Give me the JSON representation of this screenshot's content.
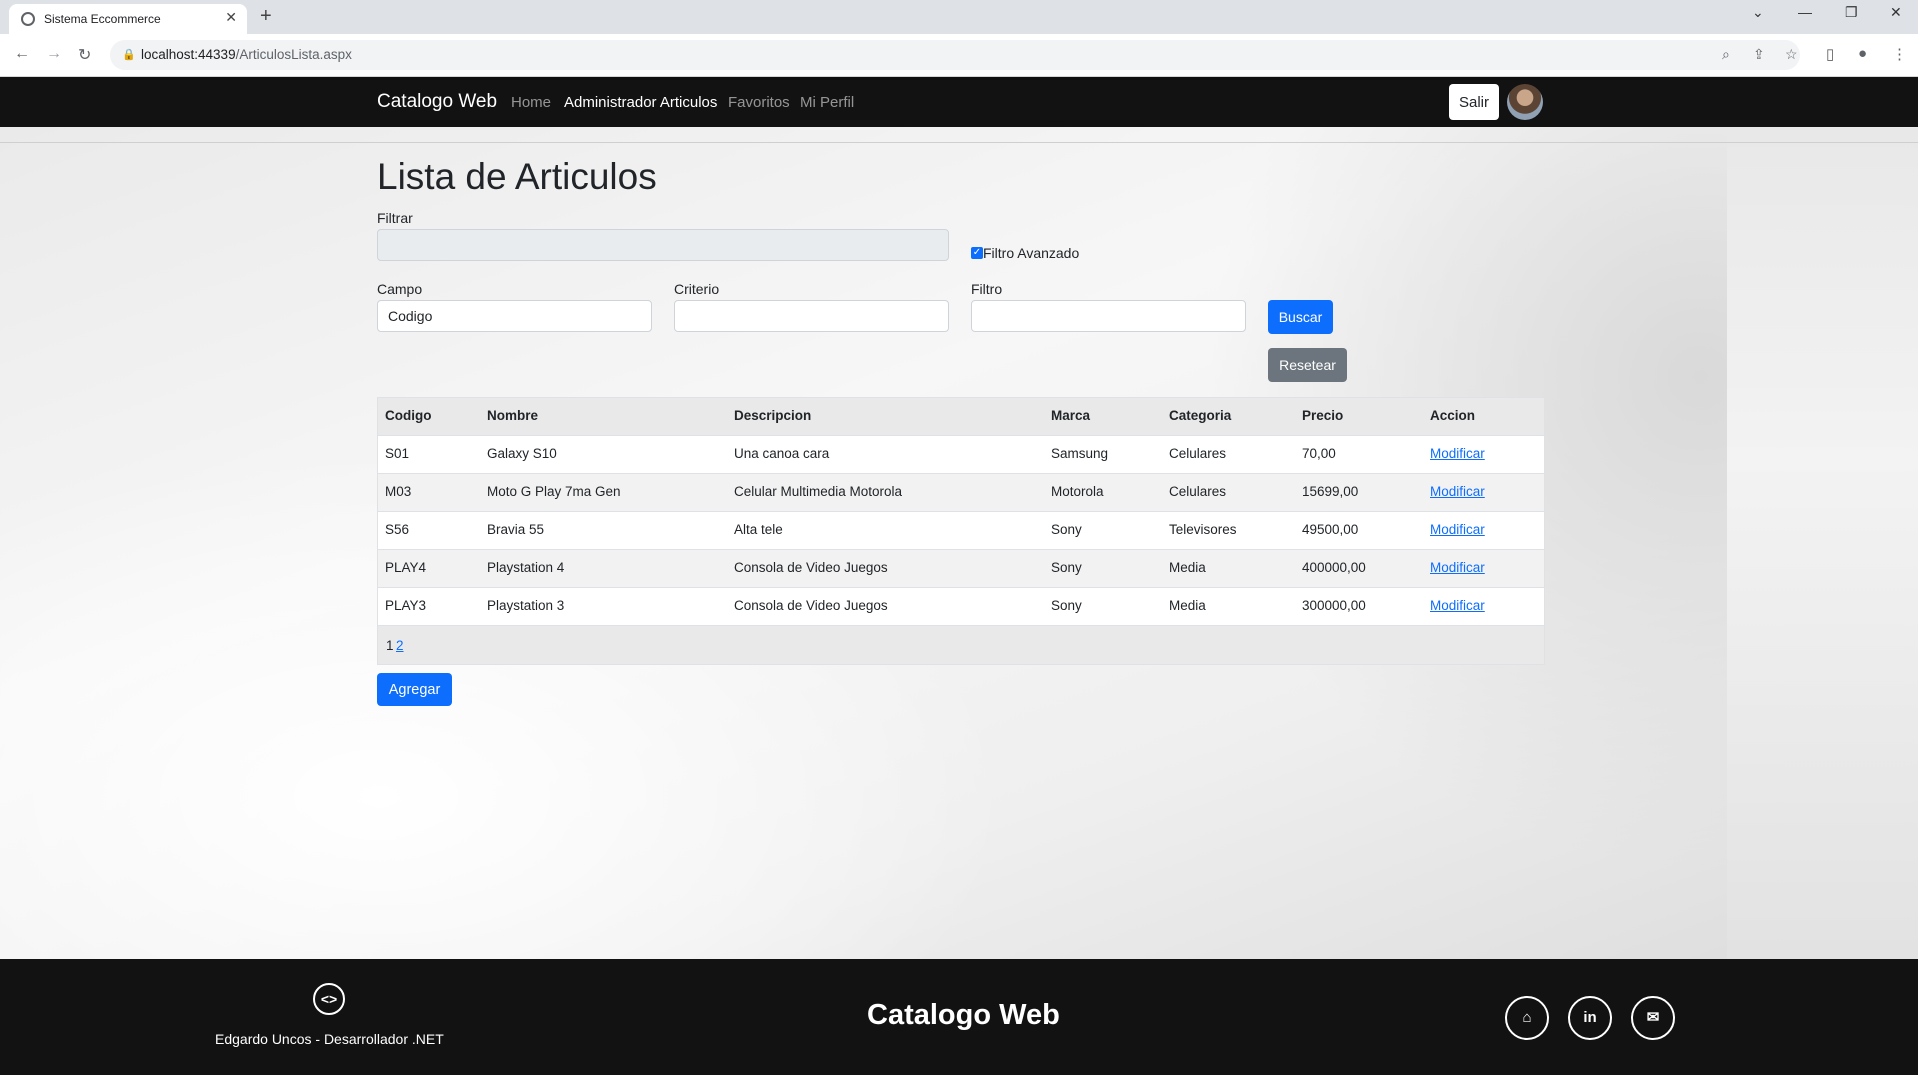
{
  "browser": {
    "tab_title": "Sistema Eccommerce",
    "url_host": "localhost:44339",
    "url_path": "/ArticulosLista.aspx"
  },
  "navbar": {
    "brand": "Catalogo Web",
    "links": [
      "Home",
      "Administrador Articulos",
      "Favoritos",
      "Mi Perfil"
    ],
    "logout_label": "Salir"
  },
  "page": {
    "title": "Lista de Articulos",
    "filter_label": "Filtrar",
    "filter_value": "",
    "advanced_filter_label": "Filtro Avanzado",
    "advanced_filter_checked": true,
    "campo_label": "Campo",
    "campo_value": "Codigo",
    "criterio_label": "Criterio",
    "criterio_value": "",
    "filtro_label": "Filtro",
    "filtro_value": "",
    "search_label": "Buscar",
    "reset_label": "Resetear",
    "add_label": "Agregar"
  },
  "table": {
    "headers": [
      "Codigo",
      "Nombre",
      "Descripcion",
      "Marca",
      "Categoria",
      "Precio",
      "Accion"
    ],
    "rows": [
      [
        "S01",
        "Galaxy S10",
        "Una canoa cara",
        "Samsung",
        "Celulares",
        "70,00",
        "Modificar"
      ],
      [
        "M03",
        "Moto G Play 7ma Gen",
        "Celular Multimedia Motorola",
        "Motorola",
        "Celulares",
        "15699,00",
        "Modificar"
      ],
      [
        "S56",
        "Bravia 55",
        "Alta tele",
        "Sony",
        "Televisores",
        "49500,00",
        "Modificar"
      ],
      [
        "PLAY4",
        "Playstation 4",
        "Consola de Video Juegos",
        "Sony",
        "Media",
        "400000,00",
        "Modificar"
      ],
      [
        "PLAY3",
        "Playstation 3",
        "Consola de Video Juegos",
        "Sony",
        "Media",
        "300000,00",
        "Modificar"
      ]
    ],
    "pager": {
      "current": "1",
      "other": "2"
    }
  },
  "footer": {
    "author": "Edgardo Uncos - Desarrollador .NET",
    "title": "Catalogo Web",
    "social_icons": [
      "github-icon",
      "linkedin-icon",
      "mail-icon"
    ]
  },
  "colors": {
    "primary": "#0d6efd",
    "secondary": "#6c757d",
    "navbar": "#121212"
  }
}
